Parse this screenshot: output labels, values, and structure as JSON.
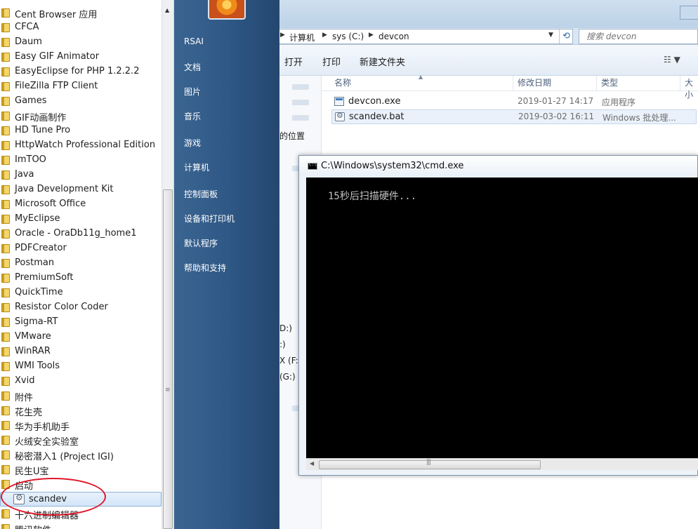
{
  "explorer": {
    "breadcrumbs": [
      "计算机",
      "sys (C:)",
      "devcon"
    ],
    "search_placeholder": "搜索 devcon",
    "toolbar": [
      "打开",
      "打印",
      "新建文件夹"
    ],
    "columns": [
      "名称",
      "修改日期",
      "类型",
      "大小"
    ],
    "files": [
      {
        "name": "devcon.exe",
        "date": "2019-01-27 14:17",
        "type": "应用程序",
        "icon": "exe-icon"
      },
      {
        "name": "scandev.bat",
        "date": "2019-03-02 16:11",
        "type": "Windows 批处理...",
        "icon": "batch-file-icon"
      }
    ],
    "nav_items": {
      "recent": "的位置",
      "drive_d": "D:)",
      "drive_e": ":)",
      "drive_f": "X (F:)",
      "drive_g": "(G:)"
    }
  },
  "cmd": {
    "title": "C:\\Windows\\system32\\cmd.exe",
    "output": "15秒后扫描硬件..."
  },
  "start_menu": {
    "programs": [
      "Cent Browser 应用",
      "CFCA",
      "Daum",
      "Easy GIF Animator",
      "EasyEclipse for PHP 1.2.2.2",
      "FileZilla FTP Client",
      "Games",
      "GIF动画制作",
      "HD Tune Pro",
      "HttpWatch Professional Edition",
      "ImTOO",
      "Java",
      "Java Development Kit",
      "Microsoft Office",
      "MyEclipse",
      "Oracle - OraDb11g_home1",
      "PDFCreator",
      "Postman",
      "PremiumSoft",
      "QuickTime",
      "Resistor Color Coder",
      "Sigma-RT",
      "VMware",
      "WinRAR",
      "WMI Tools",
      "Xvid",
      "附件",
      "花生壳",
      "华为手机助手",
      "火绒安全实验室",
      "秘密潜入1 (Project IGI)",
      "民生U宝",
      "启动"
    ],
    "selected_item": "scandev",
    "after_selected": [
      "十六进制编辑器",
      "腾讯软件"
    ],
    "right_pane": [
      "RSAI",
      "文档",
      "图片",
      "音乐",
      "游戏",
      "计算机",
      "控制面板",
      "设备和打印机",
      "默认程序",
      "帮助和支持"
    ]
  },
  "colors": {
    "highlight_circle": "#e0182c",
    "start_menu_pane": "#2f5886",
    "console_bg": "#000000",
    "console_text": "#c0c0c0"
  }
}
